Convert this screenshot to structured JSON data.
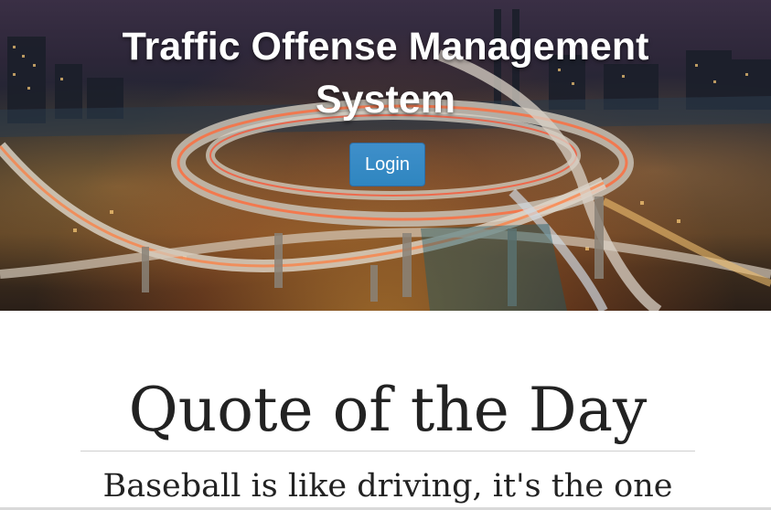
{
  "header": {
    "title": "Traffic Offense Management System",
    "login_label": "Login"
  },
  "quote": {
    "heading": "Quote of the Day",
    "text": "Baseball is like driving, it's the one"
  },
  "colors": {
    "login_button": "#337ab7",
    "title_text": "#ffffff",
    "heading_text": "#222222"
  }
}
